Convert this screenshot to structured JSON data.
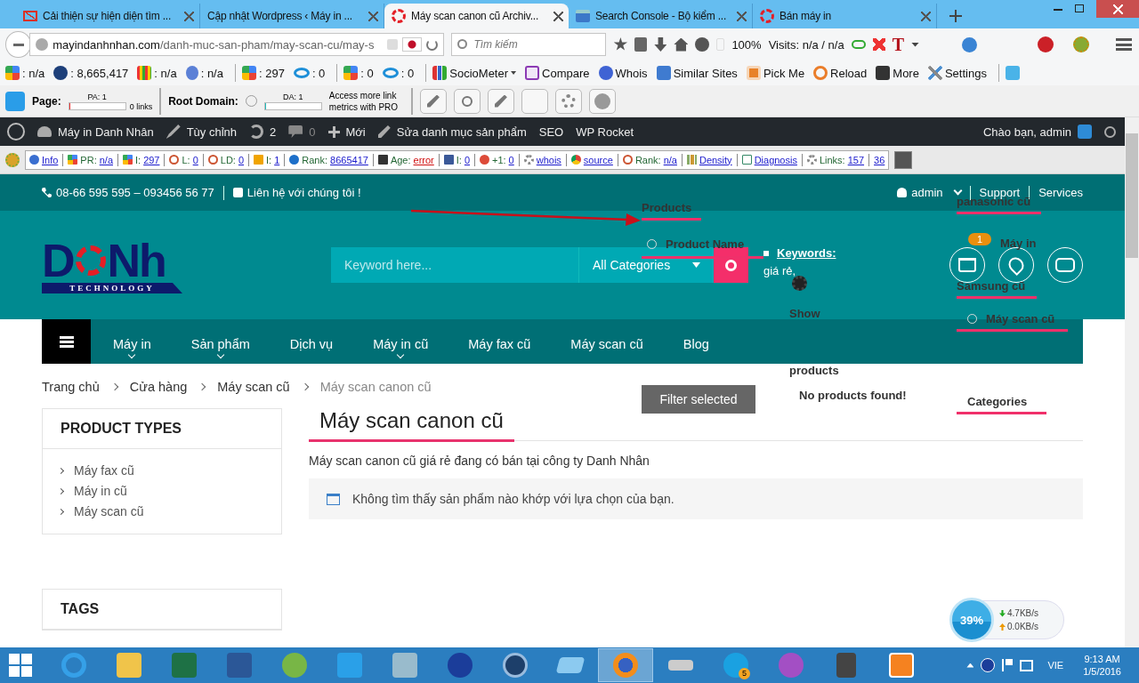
{
  "browser": {
    "tabs": [
      {
        "title": "Cải thiện sự hiện diện tìm ...",
        "selected": false
      },
      {
        "title": "Cập nhật Wordpress ‹ Máy in ...",
        "selected": false
      },
      {
        "title": "Máy scan canon cũ Archiv...",
        "selected": true
      },
      {
        "title": "Search Console - Bộ kiểm ...",
        "selected": false
      },
      {
        "title": "Bán máy in",
        "selected": false
      }
    ],
    "url_host": "mayindanhnhan.com",
    "url_path": "/danh-muc-san-pham/may-scan-cu/may-s",
    "search_placeholder": "Tìm kiếm",
    "zoom": "100%",
    "visits": "Visits: n/a / n/a",
    "t_glyph": "T",
    "seo_toolbar": [
      {
        "text": ": n/a"
      },
      {
        "text": ": 8,665,417"
      },
      {
        "text": ": n/a"
      },
      {
        "text": ": n/a"
      },
      {
        "text": ": 297"
      },
      {
        "text": ": 0"
      },
      {
        "text": ": 0"
      },
      {
        "text": ": 0"
      },
      {
        "text": "SocioMeter"
      },
      {
        "text": "Compare"
      },
      {
        "text": "Whois"
      },
      {
        "text": "Similar Sites"
      },
      {
        "text": "Pick Me"
      },
      {
        "text": "Reload"
      },
      {
        "text": "More"
      },
      {
        "text": "Settings"
      }
    ],
    "moz": {
      "page_label": "Page:",
      "pa": "PA: 1",
      "page_meter": {
        "level": 0.02
      },
      "links": "0 links",
      "root_label": "Root Domain:",
      "da": "DA: 1",
      "domain_meter": {
        "level": 0.02
      },
      "pro_note": "Access more link metrics with PRO"
    }
  },
  "wp_admin_bar": {
    "items": [
      {
        "text": "Máy in Danh Nhân"
      },
      {
        "text": "Tùy chỉnh"
      },
      {
        "text": "2"
      },
      {
        "text": "0"
      },
      {
        "text": "Mới"
      },
      {
        "text": "Sửa danh mục sản phẩm"
      },
      {
        "text": "SEO"
      },
      {
        "text": "WP Rocket"
      }
    ],
    "greeting": "Chào bạn, admin"
  },
  "seo_bar": [
    {
      "links": [
        "Info"
      ],
      "alert": false
    },
    {
      "label": "PR:",
      "links": [
        "n/a"
      ],
      "alert": false
    },
    {
      "label": "I:",
      "links": [
        "297"
      ],
      "alert": false
    },
    {
      "label": "L:",
      "links": [
        "0"
      ],
      "alert": false
    },
    {
      "label": "LD:",
      "links": [
        "0"
      ],
      "alert": false
    },
    {
      "label": "I:",
      "links": [
        "1"
      ],
      "alert": false
    },
    {
      "label": "Rank:",
      "links": [
        "8665417"
      ],
      "alert": false
    },
    {
      "label": "Age:",
      "links": [
        "error"
      ],
      "alert": true
    },
    {
      "label": "I:",
      "links": [
        "0"
      ],
      "alert": false
    },
    {
      "label": "+1:",
      "links": [
        "0"
      ],
      "alert": false
    },
    {
      "links": [
        "whois"
      ],
      "alert": false
    },
    {
      "links": [
        "source"
      ],
      "alert": false
    },
    {
      "label": "Rank:",
      "links": [
        "n/a"
      ],
      "alert": false
    },
    {
      "links": [
        "Density"
      ],
      "alert": false
    },
    {
      "links": [
        "Diagnosis"
      ],
      "alert": false
    },
    {
      "label": "Links:",
      "links": [
        "157",
        "36"
      ],
      "alert": false
    }
  ],
  "site": {
    "phone": "08-66 595 595 – 093456 56 77",
    "contact": "Liên hệ với chúng tôi !",
    "account": "admin",
    "top_links": [
      "Support",
      "Services"
    ],
    "logo": {
      "left": "D",
      "right": "Nh",
      "tagline": "TECHNOLOGY"
    },
    "search": {
      "placeholder": "Keyword here...",
      "category": "All Categories"
    },
    "cart_count": "1",
    "nav": [
      {
        "label": "Máy in",
        "submenu": true
      },
      {
        "label": "Sản phẩm",
        "submenu": true
      },
      {
        "label": "Dịch vụ",
        "submenu": false
      },
      {
        "label": "Máy in cũ",
        "submenu": true
      },
      {
        "label": "Máy fax cũ",
        "submenu": false
      },
      {
        "label": "Máy scan cũ",
        "submenu": false
      },
      {
        "label": "Blog",
        "submenu": false
      }
    ],
    "breadcrumb": [
      "Trang chủ",
      "Cửa hàng",
      "Máy scan cũ",
      "Máy scan canon cũ"
    ],
    "sidebar": [
      {
        "title": "PRODUCT TYPES",
        "items": [
          "Máy fax cũ",
          "Máy in cũ",
          "Máy scan cũ"
        ]
      },
      {
        "title": "TAGS"
      }
    ],
    "page_title": "Máy scan canon cũ",
    "description": "Máy scan canon cũ giá rẻ đang có bán tại công ty Danh Nhân",
    "notice": "Không tìm thấy sản phẩm nào khớp với lựa chọn của bạn.",
    "filter_overlay": [
      {
        "kind": "heading",
        "text": "Products"
      },
      {
        "kind": "heading",
        "text": "panasonic cũ"
      },
      {
        "kind": "radio",
        "text": "Product Name"
      },
      {
        "kind": "text",
        "text": "Máy in"
      },
      {
        "kind": "keywords",
        "text": "Keywords:"
      },
      {
        "kind": "text",
        "text": "giá rẻ,"
      },
      {
        "kind": "heading",
        "text": "Samsung cũ"
      },
      {
        "kind": "gear"
      },
      {
        "kind": "text",
        "text": "Show"
      },
      {
        "kind": "radio",
        "text": "Máy scan cũ"
      },
      {
        "kind": "text",
        "text": "products"
      },
      {
        "kind": "button",
        "text": "Filter selected"
      },
      {
        "kind": "text",
        "text": "No products found!"
      },
      {
        "kind": "heading",
        "text": "Categories"
      }
    ],
    "network": {
      "percent": "39%",
      "down": "4.7KB/s",
      "up": "0.0KB/s"
    }
  },
  "taskbar": {
    "skype_count": "5",
    "language": "VIE",
    "time": "9:13 AM",
    "date": "1/5/2016"
  }
}
